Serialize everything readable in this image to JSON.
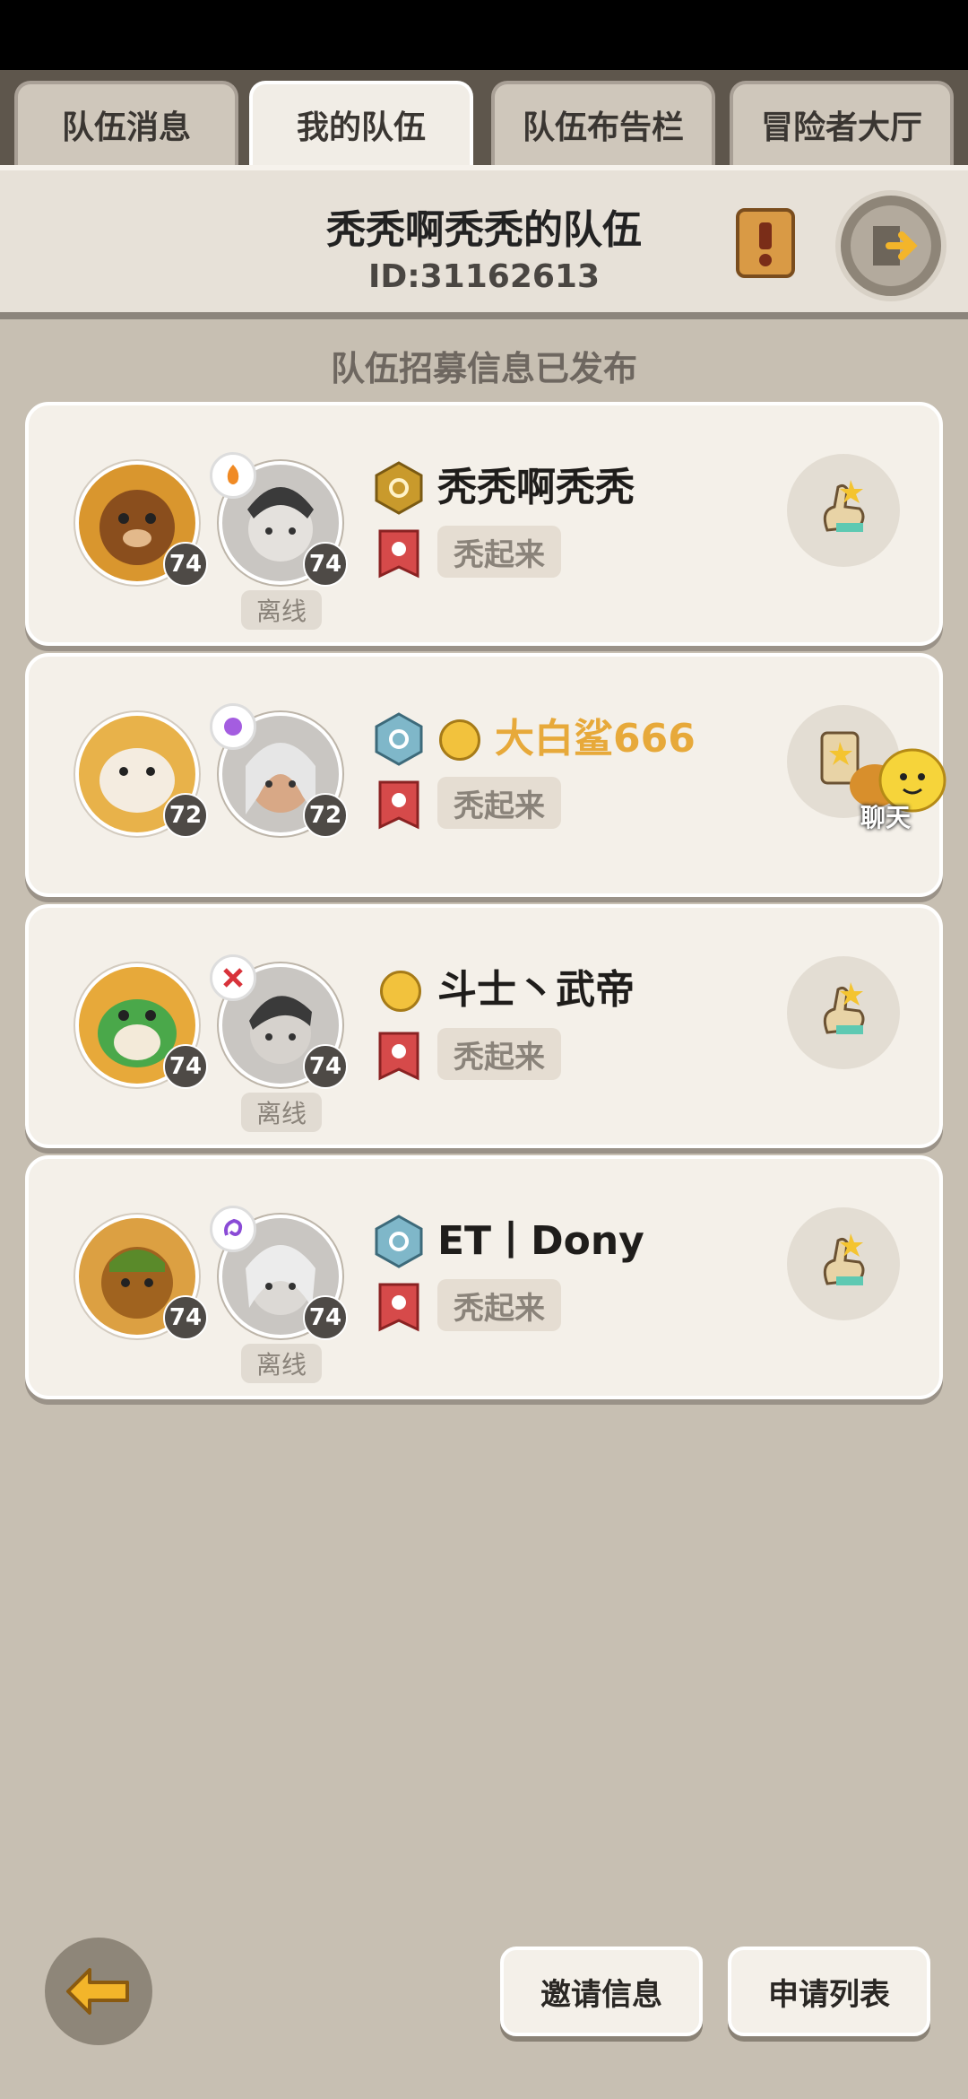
{
  "tabs": [
    {
      "label": "队伍消息"
    },
    {
      "label": "我的队伍"
    },
    {
      "label": "队伍布告栏"
    },
    {
      "label": "冒险者大厅"
    }
  ],
  "header": {
    "team_name": "秃秃啊秃秃的队伍",
    "team_id": "ID:31162613"
  },
  "recruit_notice": "队伍招募信息已发布",
  "members": [
    {
      "pet_level": "74",
      "avatar_level": "74",
      "status": "离线",
      "name": "秃秃啊秃秃",
      "title": "秃起来",
      "name_color": "#1f1d1b",
      "pet_color": "#d9962e",
      "class_color": "#f08a24"
    },
    {
      "pet_level": "72",
      "avatar_level": "72",
      "status": "",
      "name": "大白鲨666",
      "title": "秃起来",
      "name_color": "#e7a93a",
      "pet_color": "#e8b24a",
      "class_color": "#a45de0"
    },
    {
      "pet_level": "74",
      "avatar_level": "74",
      "status": "离线",
      "name": "斗士丶武帝",
      "title": "秃起来",
      "name_color": "#1f1d1b",
      "pet_color": "#e7a93a",
      "class_color": "#d8323a"
    },
    {
      "pet_level": "74",
      "avatar_level": "74",
      "status": "离线",
      "name": "ET丨Dony",
      "title": "秃起来",
      "name_color": "#1f1d1b",
      "pet_color": "#dca042",
      "class_color": "#8a4bd6"
    }
  ],
  "chat": {
    "label": "聊天"
  },
  "bottom": {
    "invite_label": "邀请信息",
    "apply_label": "申请列表"
  }
}
